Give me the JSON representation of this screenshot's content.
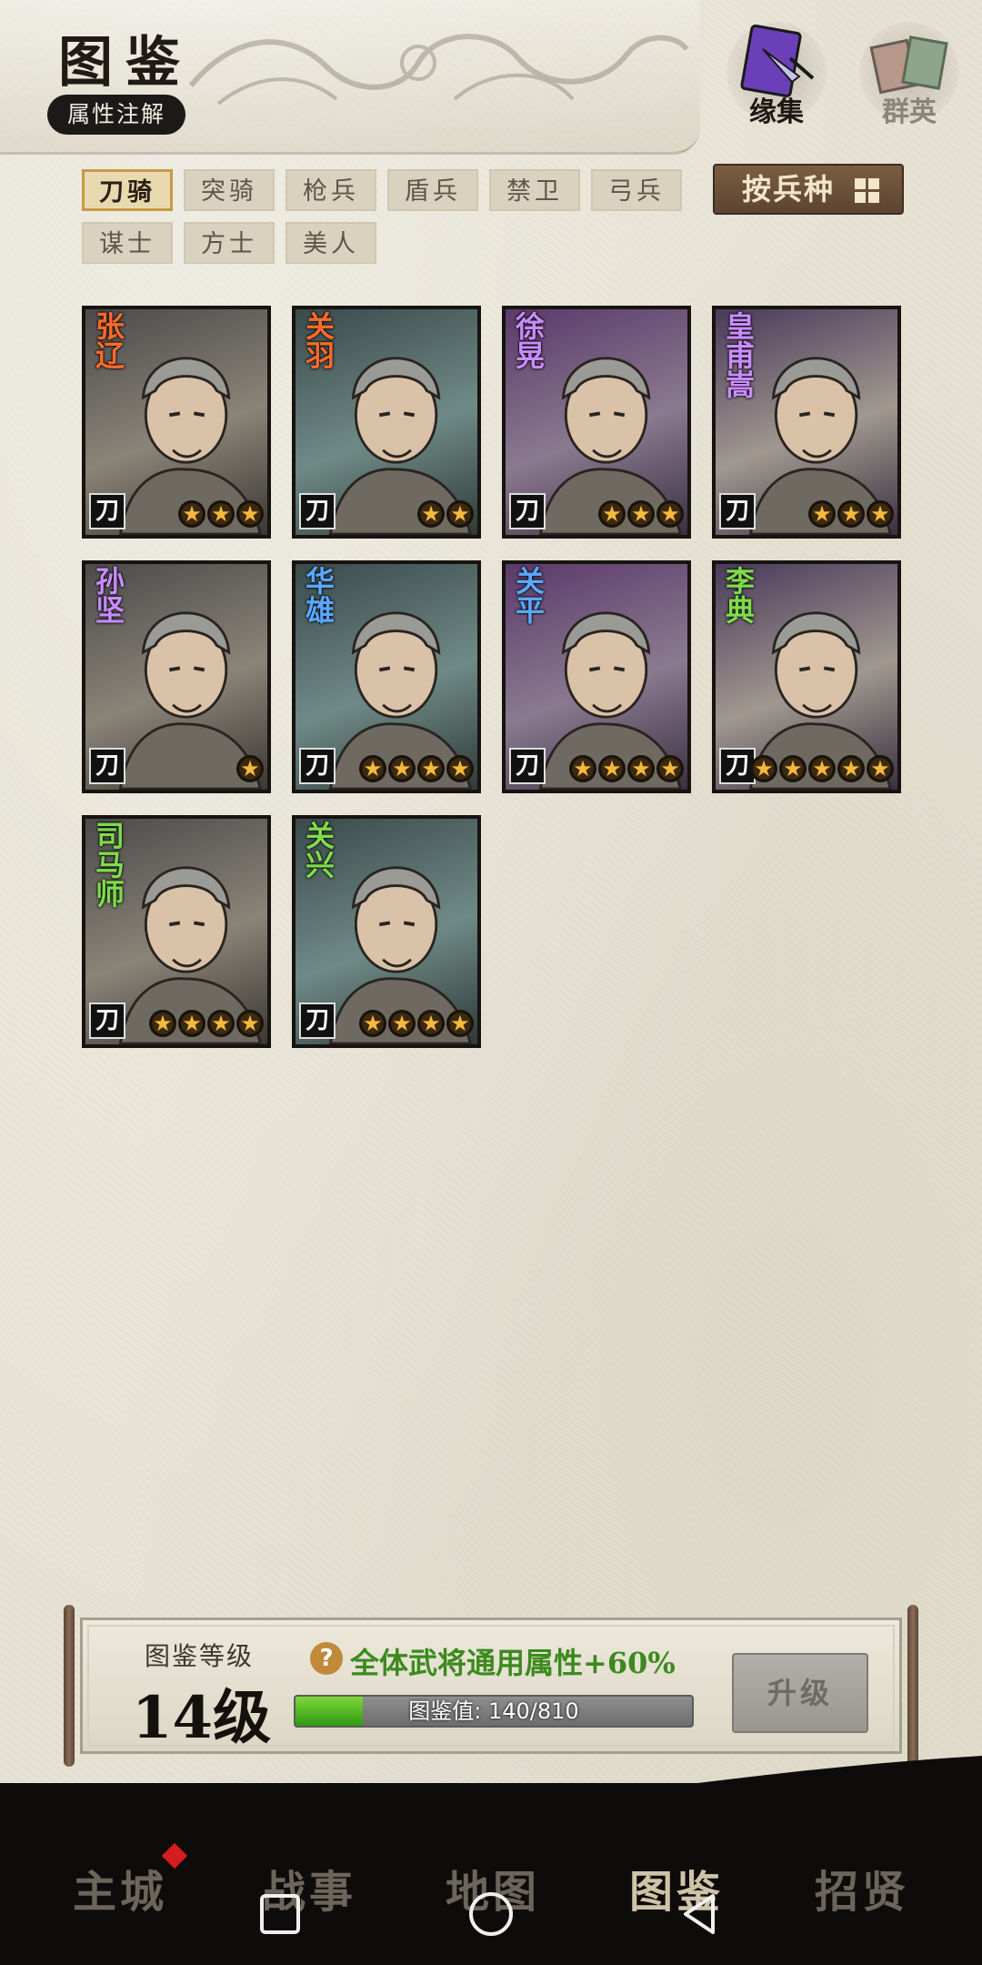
{
  "header": {
    "title": "图鉴",
    "attr_note_label": "属性注解",
    "icons": [
      {
        "name": "collection-icon",
        "label": "缘集",
        "active": true
      },
      {
        "name": "heroes-icon",
        "label": "群英",
        "active": false
      }
    ]
  },
  "filters": {
    "tabs": [
      "刀骑",
      "突骑",
      "枪兵",
      "盾兵",
      "禁卫",
      "弓兵",
      "谋士",
      "方士",
      "美人"
    ],
    "active_index": 0,
    "sort_label": "按兵种"
  },
  "heroes": [
    {
      "name": "张辽",
      "type": "刀",
      "stars": 3,
      "name_color": "#ff6a2a"
    },
    {
      "name": "关羽",
      "type": "刀",
      "stars": 2,
      "name_color": "#ff6a2a"
    },
    {
      "name": "徐晃",
      "type": "刀",
      "stars": 3,
      "name_color": "#c98cff"
    },
    {
      "name": "皇甫嵩",
      "type": "刀",
      "stars": 3,
      "name_color": "#c98cff"
    },
    {
      "name": "孙坚",
      "type": "刀",
      "stars": 1,
      "name_color": "#c98cff"
    },
    {
      "name": "华雄",
      "type": "刀",
      "stars": 4,
      "name_color": "#5aa8ff"
    },
    {
      "name": "关平",
      "type": "刀",
      "stars": 4,
      "name_color": "#5aa8ff"
    },
    {
      "name": "李典",
      "type": "刀",
      "stars": 5,
      "name_color": "#7fdc4c"
    },
    {
      "name": "司马师",
      "type": "刀",
      "stars": 4,
      "name_color": "#7fdc4c"
    },
    {
      "name": "关兴",
      "type": "刀",
      "stars": 4,
      "name_color": "#7fdc4c"
    }
  ],
  "level_panel": {
    "caption": "图鉴等级",
    "level": "14级",
    "bonus": "全体武将通用属性+60%",
    "progress_label": "图鉴值: 140/810",
    "progress_fraction": 0.17,
    "upgrade_label": "升级"
  },
  "nav": {
    "items": [
      "主城",
      "战事",
      "地图",
      "图鉴",
      "招贤"
    ],
    "active_index": 3
  }
}
